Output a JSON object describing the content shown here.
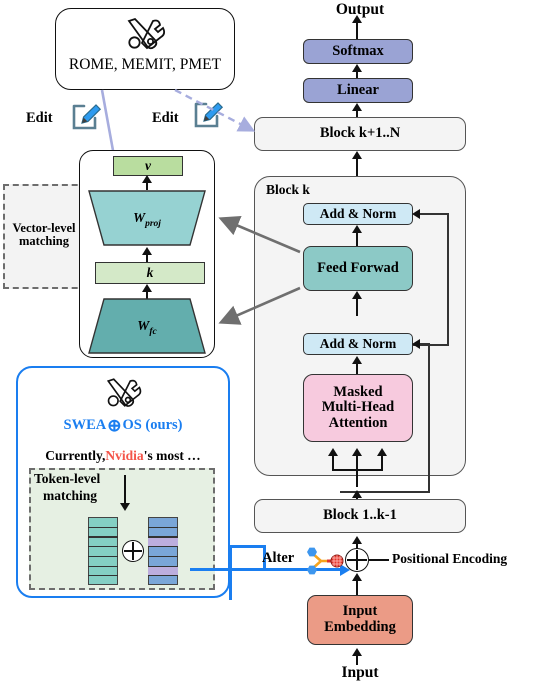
{
  "figure": {
    "title_semantics": "SWEA token-level model editing vs vector-level editing in a Transformer"
  },
  "editors_panel": {
    "icon": "tools-wrench-screwdriver-icon",
    "label": "ROME, MEMIT, PMET",
    "edit_label_left": "Edit",
    "edit_label_right": "Edit",
    "edit_icon": "pencil-edit-icon"
  },
  "ffn_panel": {
    "v_label": "v",
    "w_proj_label": "W_proj",
    "w_proj_sub": "proj",
    "w_proj_main": "W",
    "k_label": "k",
    "w_fc_main": "W",
    "w_fc_sub": "fc",
    "group_label_line1": "Vector-level",
    "group_label_line2": "matching"
  },
  "swea_panel": {
    "icon": "tools-wrench-screwdriver-icon",
    "title_prefix": "SWEA",
    "title_op": "⊕",
    "title_suffix": "OS (ours)",
    "sentence_part1": "Currently, ",
    "sentence_highlight": "Nvidia",
    "sentence_part2": "'s most …",
    "match_label_line1": "Token-level",
    "match_label_line2": "matching",
    "op_symbol": "⊕",
    "left_column_cells": 7,
    "right_column_cells": 7,
    "right_highlight_indices": [
      2,
      5
    ]
  },
  "transformer": {
    "output_label": "Output",
    "softmax_label": "Softmax",
    "linear_label": "Linear",
    "block_upper_label": "Block k+1..N",
    "block_k_label": "Block k",
    "add_norm_top_label": "Add & Norm",
    "feed_forward_label": "Feed Forwad",
    "add_norm_bottom_label": "Add & Norm",
    "attention_line1": "Masked",
    "attention_line2": "Multi-Head",
    "attention_line3": "Attention",
    "block_lower_label": "Block 1..k-1",
    "positional_encoding_label": "Positional Encoding",
    "positional_op": "⊕",
    "alter_label": "Alter",
    "alter_icon": "alter-molecule-icon",
    "input_embedding_line1": "Input",
    "input_embedding_line2": "Embedding",
    "input_label": "Input"
  },
  "colors": {
    "softmax": "#9aa3d4",
    "linear": "#9aa3d4",
    "add_norm": "#cfe9f5",
    "feed_forward": "#8cc9c6",
    "attention": "#f7cade",
    "input_embedding": "#eb9b86",
    "block_fill": "#f4f4f4",
    "v_box": "#b9dd9f",
    "k_box": "#d4e9c8",
    "w_proj": "#96d2d2",
    "w_fc": "#63aead",
    "token_left": "#84cfc4",
    "token_right": "#7aa6d8",
    "token_right_highlight": "#bdaede",
    "swea_accent": "#1a7ef0",
    "nvidia_red": "#f4554a",
    "edit_arrow": "#a7adde",
    "gray_arrow": "#6f6f6f",
    "match_bg": "#e6f0e3"
  }
}
